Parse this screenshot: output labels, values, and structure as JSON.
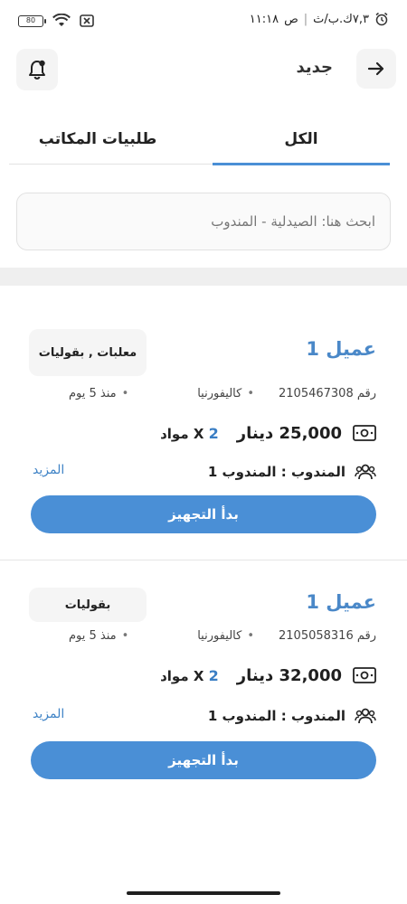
{
  "status_bar": {
    "battery": "80",
    "time": "١١:١٨",
    "ampm": "ص",
    "speed": "٧,٣ك.ب/ث"
  },
  "header": {
    "title": "جديد",
    "back_icon": "arrow-right-icon",
    "bell_icon": "bell-icon"
  },
  "tabs": [
    {
      "label": "الكل",
      "active": true
    },
    {
      "label": "طلبيات المكاتب",
      "active": false
    }
  ],
  "search": {
    "placeholder": "ابحث هنا: الصيدلية - المندوب"
  },
  "orders": [
    {
      "client": "عميل 1",
      "categories": "معلبات , بقوليات",
      "order_number": "رقم 2105467308",
      "city": "كاليفورنيا",
      "age": "منذ 5 يوم",
      "price": "25,000 دينار",
      "qty_num": "2",
      "qty_label": "X مواد",
      "agent": "المندوب : المندوب 1",
      "more": "المزيد",
      "action": "بدأ التجهيز"
    },
    {
      "client": "عميل 1",
      "categories": "بقوليات",
      "order_number": "رقم 2105058316",
      "city": "كاليفورنيا",
      "age": "منذ 5 يوم",
      "price": "32,000 دينار",
      "qty_num": "2",
      "qty_label": "X مواد",
      "agent": "المندوب : المندوب 1",
      "more": "المزيد",
      "action": "بدأ التجهيز"
    }
  ],
  "colors": {
    "accent": "#4a8fd6",
    "client_name": "#4a88c8",
    "link": "#3f83c6"
  }
}
